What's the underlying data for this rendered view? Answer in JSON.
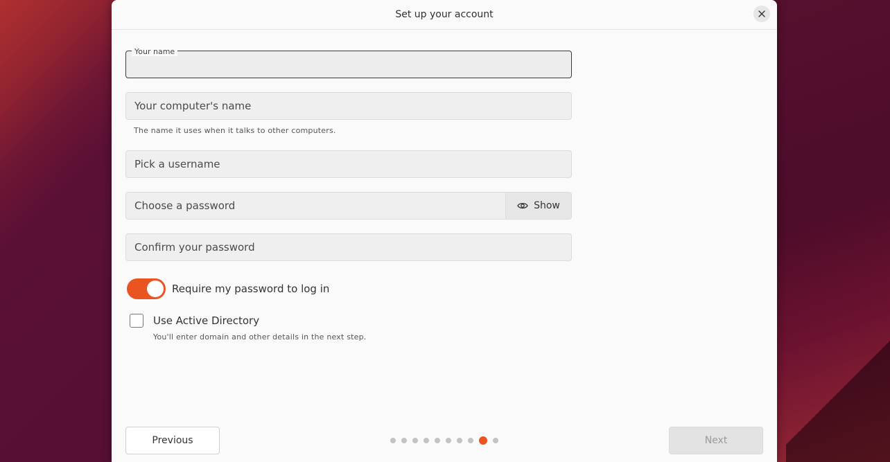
{
  "window": {
    "title": "Set up your account"
  },
  "form": {
    "name_label": "Your name",
    "name_value": "",
    "computer_placeholder": "Your computer's name",
    "computer_helper": "The name it uses when it talks to other computers.",
    "username_placeholder": "Pick a username",
    "password_placeholder": "Choose a password",
    "show_label": "Show",
    "confirm_placeholder": "Confirm your password",
    "require_password_label": "Require my password to log in",
    "require_password_on": true,
    "ad_label": "Use Active Directory",
    "ad_checked": false,
    "ad_helper": "You'll enter domain and other details in the next step."
  },
  "footer": {
    "previous_label": "Previous",
    "next_label": "Next",
    "step_current": 9,
    "step_total": 10
  },
  "colors": {
    "accent": "#e95420",
    "desktop": "#4a0d2c"
  },
  "icons": {
    "close": "close-icon",
    "eye": "eye-icon"
  }
}
